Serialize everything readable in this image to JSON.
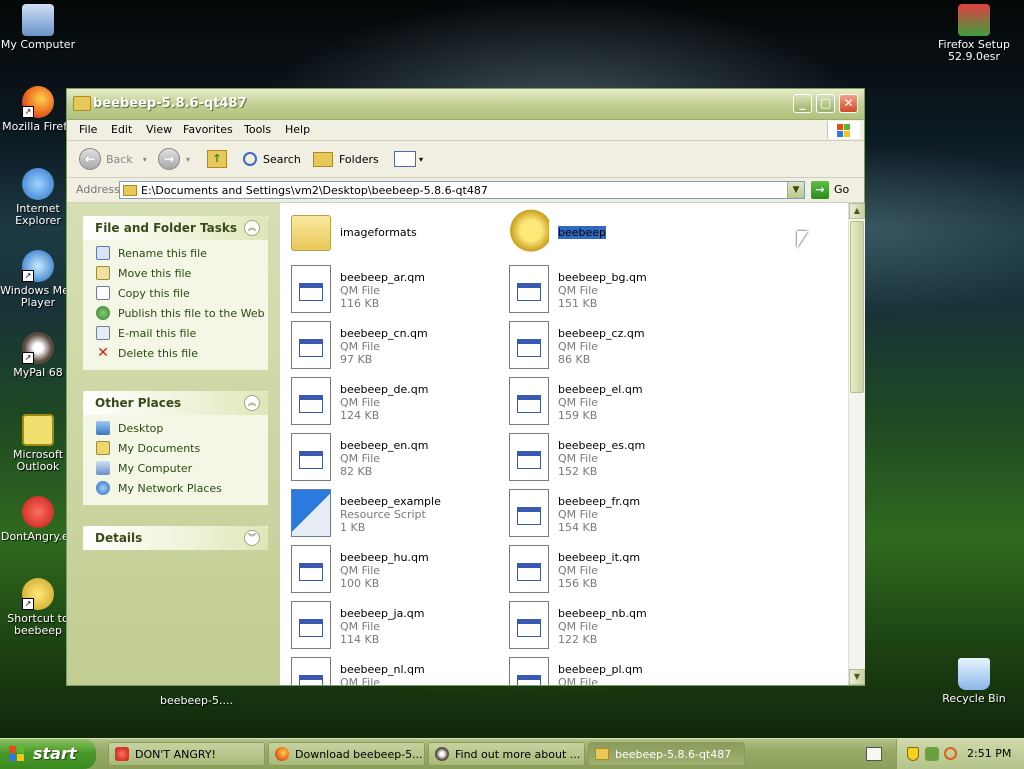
{
  "desktop": {
    "icons": [
      {
        "label": "My Computer",
        "icon": "my-computer-icon"
      },
      {
        "label": "Mozilla Firefo",
        "icon": "firefox-icon"
      },
      {
        "label": "Internet Explorer",
        "icon": "internet-explorer-icon"
      },
      {
        "label": "Windows Med Player",
        "icon": "media-player-icon"
      },
      {
        "label": "MyPal 68",
        "icon": "mypal-icon"
      },
      {
        "label": "Microsoft Outlook",
        "icon": "outlook-icon"
      },
      {
        "label": "DontAngry.ex",
        "icon": "dontangry-icon"
      },
      {
        "label": "Shortcut to beebeep",
        "icon": "beebeep-shortcut-icon"
      },
      {
        "label": "Firefox Setup 52.9.0esr",
        "icon": "firefox-setup-icon"
      },
      {
        "label": "Recycle Bin",
        "icon": "recycle-bin-icon"
      }
    ],
    "dragging_label": "beebeep-5...."
  },
  "window": {
    "title": "beebeep-5.8.6-qt487",
    "menu": [
      "File",
      "Edit",
      "View",
      "Favorites",
      "Tools",
      "Help"
    ],
    "toolbar": {
      "back": "Back",
      "search": "Search",
      "folders": "Folders"
    },
    "address": {
      "label": "Address",
      "value": "E:\\Documents and Settings\\vm2\\Desktop\\beebeep-5.8.6-qt487",
      "go": "Go"
    }
  },
  "tasks": {
    "file_folder": {
      "title": "File and Folder Tasks",
      "items": [
        {
          "label": "Rename this file",
          "icon": "rename-icon"
        },
        {
          "label": "Move this file",
          "icon": "move-icon"
        },
        {
          "label": "Copy this file",
          "icon": "copy-icon"
        },
        {
          "label": "Publish this file to the Web",
          "icon": "publish-icon"
        },
        {
          "label": "E-mail this file",
          "icon": "email-icon"
        },
        {
          "label": "Delete this file",
          "icon": "delete-icon"
        }
      ]
    },
    "other_places": {
      "title": "Other Places",
      "items": [
        {
          "label": "Desktop",
          "icon": "desktop-icon"
        },
        {
          "label": "My Documents",
          "icon": "my-documents-icon"
        },
        {
          "label": "My Computer",
          "icon": "my-computer-icon"
        },
        {
          "label": "My Network Places",
          "icon": "network-icon"
        }
      ]
    },
    "details": {
      "title": "Details"
    }
  },
  "files": [
    {
      "name": "imageformats",
      "type": "",
      "size": "",
      "kind": "folder"
    },
    {
      "name": "beebeep",
      "type": "",
      "size": "",
      "kind": "app",
      "selected": true
    },
    {
      "name": "beebeep_ar.qm",
      "type": "QM File",
      "size": "116 KB",
      "kind": "qm"
    },
    {
      "name": "beebeep_bg.qm",
      "type": "QM File",
      "size": "151 KB",
      "kind": "qm"
    },
    {
      "name": "beebeep_cn.qm",
      "type": "QM File",
      "size": "97 KB",
      "kind": "qm"
    },
    {
      "name": "beebeep_cz.qm",
      "type": "QM File",
      "size": "86 KB",
      "kind": "qm"
    },
    {
      "name": "beebeep_de.qm",
      "type": "QM File",
      "size": "124 KB",
      "kind": "qm"
    },
    {
      "name": "beebeep_el.qm",
      "type": "QM File",
      "size": "159 KB",
      "kind": "qm"
    },
    {
      "name": "beebeep_en.qm",
      "type": "QM File",
      "size": "82 KB",
      "kind": "qm"
    },
    {
      "name": "beebeep_es.qm",
      "type": "QM File",
      "size": "152 KB",
      "kind": "qm"
    },
    {
      "name": "beebeep_example",
      "type": "Resource Script",
      "size": "1 KB",
      "kind": "script"
    },
    {
      "name": "beebeep_fr.qm",
      "type": "QM File",
      "size": "154 KB",
      "kind": "qm"
    },
    {
      "name": "beebeep_hu.qm",
      "type": "QM File",
      "size": "100 KB",
      "kind": "qm"
    },
    {
      "name": "beebeep_it.qm",
      "type": "QM File",
      "size": "156 KB",
      "kind": "qm"
    },
    {
      "name": "beebeep_ja.qm",
      "type": "QM File",
      "size": "114 KB",
      "kind": "qm"
    },
    {
      "name": "beebeep_nb.qm",
      "type": "QM File",
      "size": "122 KB",
      "kind": "qm"
    },
    {
      "name": "beebeep_nl.qm",
      "type": "QM File",
      "size": "",
      "kind": "qm"
    },
    {
      "name": "beebeep_pl.qm",
      "type": "QM File",
      "size": "",
      "kind": "qm"
    }
  ],
  "taskbar": {
    "start": "start",
    "tasks": [
      {
        "label": "DON'T ANGRY!",
        "icon": "dontangry-icon",
        "active": false
      },
      {
        "label": "Download beebeep-5...",
        "icon": "firefox-icon",
        "active": false
      },
      {
        "label": "Find out more about ...",
        "icon": "mypal-icon",
        "active": false
      },
      {
        "label": "beebeep-5.8.6-qt487",
        "icon": "folder-icon",
        "active": true
      }
    ],
    "clock": "2:51 PM"
  },
  "colors": {
    "selection": "#316ac5",
    "link": "#2c4a12",
    "accent": "#b0c27c"
  }
}
